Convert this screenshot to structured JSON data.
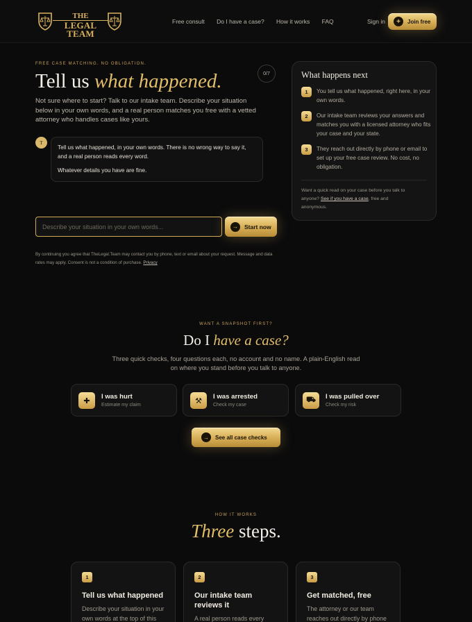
{
  "brand": {
    "logo_line1": "THE",
    "logo_line2": "LEGAL TEAM"
  },
  "nav": {
    "links": [
      "Free consult",
      "Do I have a case?",
      "How it works",
      "FAQ"
    ],
    "sign_in": "Sign in",
    "join_label": "Join free"
  },
  "hero": {
    "eyebrow": "FREE CASE MATCHING. NO OBLIGATION.",
    "title_plain": "Tell us",
    "title_italic": "what happened.",
    "counter": "0/7",
    "lead": "Not sure where to start? Talk to our intake team. Describe your situation below in your own words, and a real person matches you free with a vetted attorney who handles cases like yours.",
    "avatar_letter": "T",
    "bubble_line1": "Tell us what happened, in your own words. There is no wrong way to say it, and a real person reads every word.",
    "bubble_line2": "Whatever details you have are fine.",
    "input_placeholder": "Describe your situation in your own words...",
    "start_label": "Start now",
    "consent_text": "By continuing you agree that TheLegal.Team may contact you by phone, text or email about your request. Message and data rates may apply. Consent is not a condition of purchase.",
    "privacy_label": "Privacy"
  },
  "next_card": {
    "title": "What happens next",
    "steps": [
      {
        "num": "1",
        "text": "You tell us what happened, right here, in your own words."
      },
      {
        "num": "2",
        "text": "Our intake team reviews your answers and matches you with a licensed attorney who fits your case and your state."
      },
      {
        "num": "3",
        "text": "They reach out directly by phone or email to set up your free case review. No cost, no obligation."
      }
    ],
    "foot_before": "Want a quick read on your case before you talk to anyone?",
    "foot_link": "See if you have a case",
    "foot_after": ", free and anonymous."
  },
  "snapshot": {
    "eyebrow": "WANT A SNAPSHOT FIRST?",
    "title_plain": "Do I",
    "title_italic": "have a case?",
    "sub": "Three quick checks, four questions each, no account and no name. A plain-English read on where you stand before you talk to anyone.",
    "checks": [
      {
        "title": "I was hurt",
        "sub": "Estimate my claim",
        "icon": "medical-cross-icon"
      },
      {
        "title": "I was arrested",
        "sub": "Check my case",
        "icon": "gavel-icon"
      },
      {
        "title": "I was pulled over",
        "sub": "Check my risk",
        "icon": "car-icon"
      }
    ],
    "see_all_label": "See all case checks"
  },
  "how": {
    "eyebrow": "HOW IT WORKS",
    "title_italic": "Three",
    "title_plain": "steps.",
    "steps": [
      {
        "num": "1",
        "title": "Tell us what happened",
        "desc": "Describe your situation in your own words at the top of this"
      },
      {
        "num": "2",
        "title": "Our intake team reviews it",
        "desc": "A real person reads every"
      },
      {
        "num": "3",
        "title": "Get matched, free",
        "desc": "The attorney or our team reaches out directly by phone"
      }
    ]
  },
  "colors": {
    "accent_gold": "#d9b25e",
    "background": "#0b0b0c"
  }
}
